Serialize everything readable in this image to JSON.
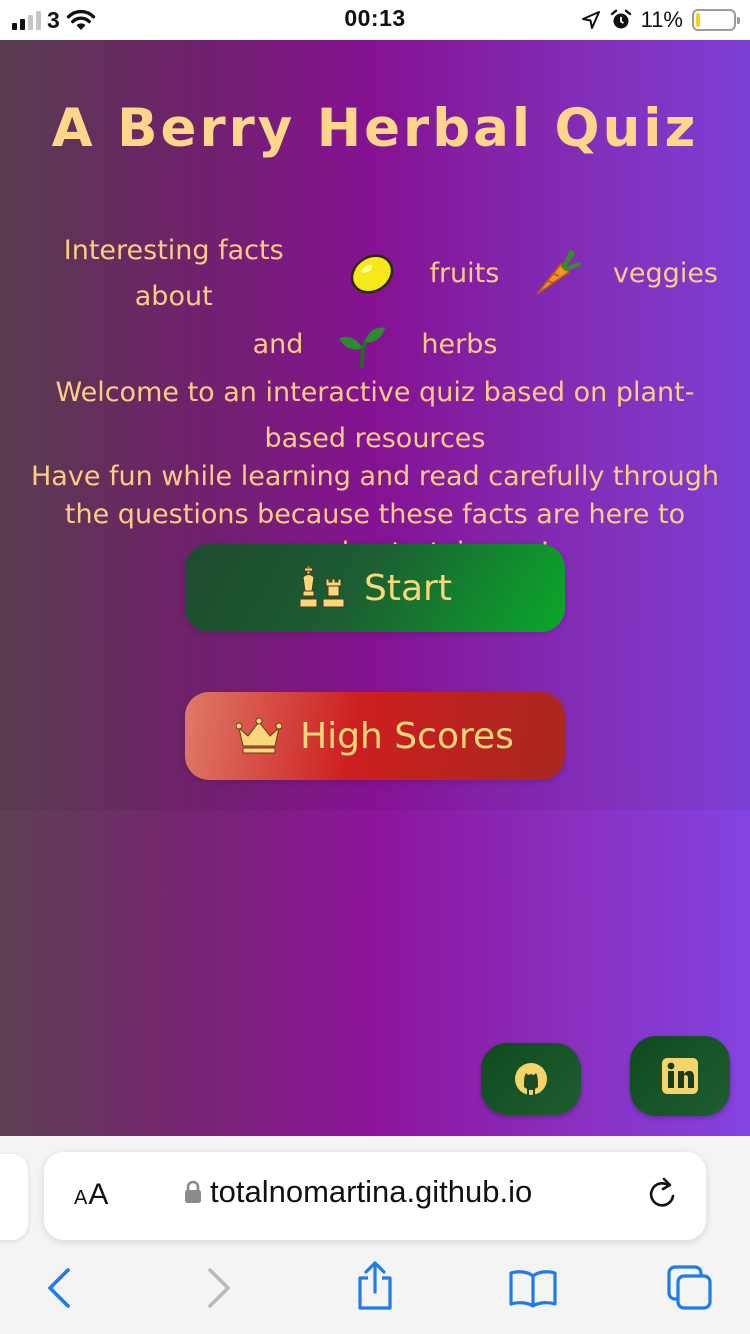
{
  "status_bar": {
    "carrier": "3",
    "time": "00:13",
    "battery_percent": "11%",
    "battery_level": 0.11,
    "signal_bars": 2
  },
  "page": {
    "title": "A Berry Herbal Quiz",
    "intro": {
      "w1": "Interesting facts about",
      "w2": "fruits",
      "w3": "veggies",
      "w4": "and",
      "w5": "herbs",
      "line2": "Welcome to an interactive quiz based on plant-based resources",
      "line3": "Have fun while learning and read carefully through the questions because these facts are here to amaze and entertain you!",
      "icons": [
        "lemon-icon",
        "carrot-icon",
        "seedling-icon"
      ]
    },
    "buttons": {
      "start_label": "Start",
      "start_icon": "chess-icon",
      "scores_label": "High Scores",
      "scores_icon": "crown-icon"
    },
    "social": [
      "github-icon",
      "linkedin-icon"
    ],
    "colors": {
      "title": "#ffd68a",
      "text": "#fccd83",
      "start_button": "#1c5d32",
      "scores_button": "#cc1f1f"
    }
  },
  "browser": {
    "text_size_label": "AA",
    "url": "totalnomartina.github.io",
    "icons": [
      "lock-icon",
      "reload-icon",
      "back-icon",
      "forward-icon",
      "share-icon",
      "bookmarks-icon",
      "tabs-icon"
    ]
  }
}
